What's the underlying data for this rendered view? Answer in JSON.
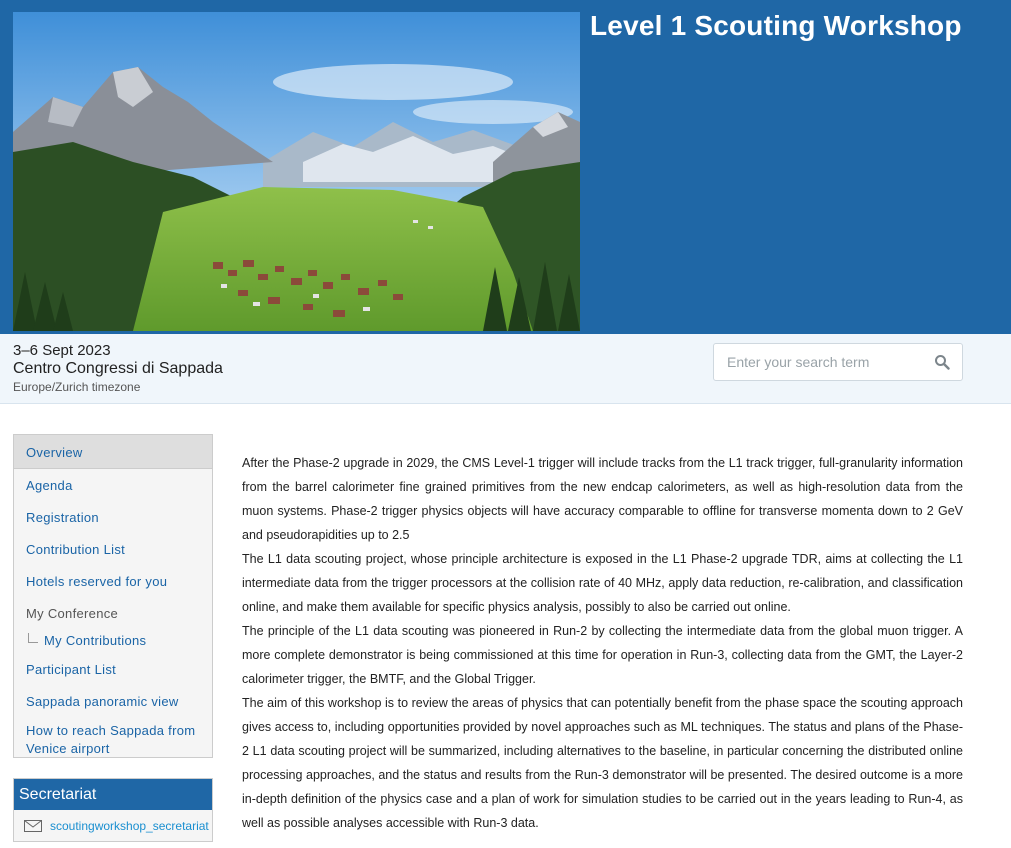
{
  "event": {
    "title": "Level 1 Scouting Workshop",
    "dates": "3–6 Sept 2023",
    "venue": "Centro Congressi di Sappada",
    "timezone": "Europe/Zurich timezone"
  },
  "search": {
    "placeholder": "Enter your search term",
    "icon": "search-icon"
  },
  "menu": {
    "items": [
      {
        "label": "Overview"
      },
      {
        "label": "Agenda"
      },
      {
        "label": "Registration"
      },
      {
        "label": "Contribution List"
      },
      {
        "label": "Hotels reserved for you"
      },
      {
        "label": "My Conference"
      },
      {
        "label": "My Contributions"
      },
      {
        "label": "Participant List"
      },
      {
        "label": "Sappada panoramic view"
      },
      {
        "label": "How to reach Sappada from Venice airport"
      }
    ]
  },
  "secretariat": {
    "title": "Secretariat",
    "email": "scoutingworkshop_secretariat",
    "icon": "mail-icon"
  },
  "description": {
    "paragraphs": [
      "After the Phase-2 upgrade in 2029, the CMS Level-1 trigger will include tracks from the L1 track trigger, full-granularity information from the barrel calorimeter fine grained primitives from the new endcap calorimeters, as well as high-resolution data from the muon systems. Phase-2 trigger physics objects will have accuracy comparable to offline for transverse momenta down to 2 GeV and pseudorapidities up to 2.5",
      "The L1 data scouting project, whose principle architecture is exposed in the L1 Phase-2 upgrade TDR, aims at collecting the L1 intermediate data from the trigger processors at the collision rate of 40 MHz, apply data reduction, re-calibration, and classification online, and make them available for specific physics analysis, possibly to also be carried out online.",
      "The principle of the L1 data scouting was pioneered in Run-2 by collecting the intermediate data from the global muon trigger. A more complete demonstrator is being commissioned at this time for operation in Run-3, collecting data from the GMT, the Layer-2 calorimeter trigger, the BMTF, and the Global Trigger.",
      "The aim of this workshop is to review the areas of physics that can potentially benefit from the  phase space the scouting approach gives access to, including opportunities provided by novel approaches such as ML techniques. The status and plans of the Phase-2 L1 data scouting project will be summarized, including alternatives to the baseline, in particular concerning the distributed online processing approaches, and the status and results from the Run-3 demonstrator will be presented. The desired outcome is a more in-depth definition of the physics case and a plan of work for simulation studies to be carried out in the years leading to Run-4, as well as possible analyses accessible with Run-3 data."
    ]
  },
  "colors": {
    "header_bg": "#1f67a6",
    "infobar_bg": "#f0f6fb",
    "link": "#1a64a6"
  }
}
